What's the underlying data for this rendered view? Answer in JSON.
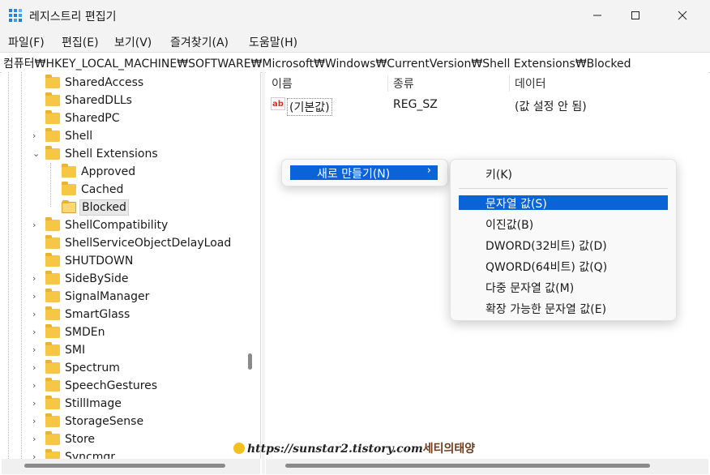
{
  "window": {
    "title": "레지스트리 편집기"
  },
  "menu": [
    "파일(F)",
    "편집(E)",
    "보기(V)",
    "즐겨찾기(A)",
    "도움말(H)"
  ],
  "address": "컴퓨터₩HKEY_LOCAL_MACHINE₩SOFTWARE₩Microsoft₩Windows₩CurrentVersion₩Shell Extensions₩Blocked",
  "tree": {
    "items": [
      {
        "label": "SharedAccess",
        "chevron": ""
      },
      {
        "label": "SharedDLLs",
        "chevron": ""
      },
      {
        "label": "SharedPC",
        "chevron": ""
      },
      {
        "label": "Shell",
        "chevron": "›"
      },
      {
        "label": "Shell Extensions",
        "chevron": "⌄"
      },
      {
        "label": "Approved",
        "chevron": ""
      },
      {
        "label": "Cached",
        "chevron": ""
      },
      {
        "label": "Blocked",
        "chevron": ""
      },
      {
        "label": "ShellCompatibility",
        "chevron": "›"
      },
      {
        "label": "ShellServiceObjectDelayLoad",
        "chevron": ""
      },
      {
        "label": "SHUTDOWN",
        "chevron": ""
      },
      {
        "label": "SideBySide",
        "chevron": "›"
      },
      {
        "label": "SignalManager",
        "chevron": "›"
      },
      {
        "label": "SmartGlass",
        "chevron": "›"
      },
      {
        "label": "SMDEn",
        "chevron": "›"
      },
      {
        "label": "SMI",
        "chevron": "›"
      },
      {
        "label": "Spectrum",
        "chevron": "›"
      },
      {
        "label": "SpeechGestures",
        "chevron": "›"
      },
      {
        "label": "StillImage",
        "chevron": "›"
      },
      {
        "label": "StorageSense",
        "chevron": "›"
      },
      {
        "label": "Store",
        "chevron": "›"
      },
      {
        "label": "Syncmgr",
        "chevron": "›"
      }
    ]
  },
  "list": {
    "columns": [
      "이름",
      "종류",
      "데이터"
    ],
    "rows": [
      {
        "name": "(기본값)",
        "type": "REG_SZ",
        "data": "(값 설정 안 됨)"
      }
    ]
  },
  "context_menu": {
    "new_label": "새로 만들기(N)",
    "arrow": "›"
  },
  "submenu": {
    "key": "키(K)",
    "items": [
      "문자열 값(S)",
      "이진값(B)",
      "DWORD(32비트) 값(D)",
      "QWORD(64비트) 값(Q)",
      "다중 문자열 값(M)",
      "확장 가능한 문자열 값(E)"
    ]
  },
  "watermark": {
    "url": "https://sunstar2.tistory.com",
    "name": "세티의태양"
  },
  "colors": {
    "accent": "#0a64d8",
    "folder": "#f6c745",
    "titlebar": "#f3f3f3"
  },
  "icons": {
    "value": "ab-string-icon",
    "folder": "folder-icon"
  }
}
